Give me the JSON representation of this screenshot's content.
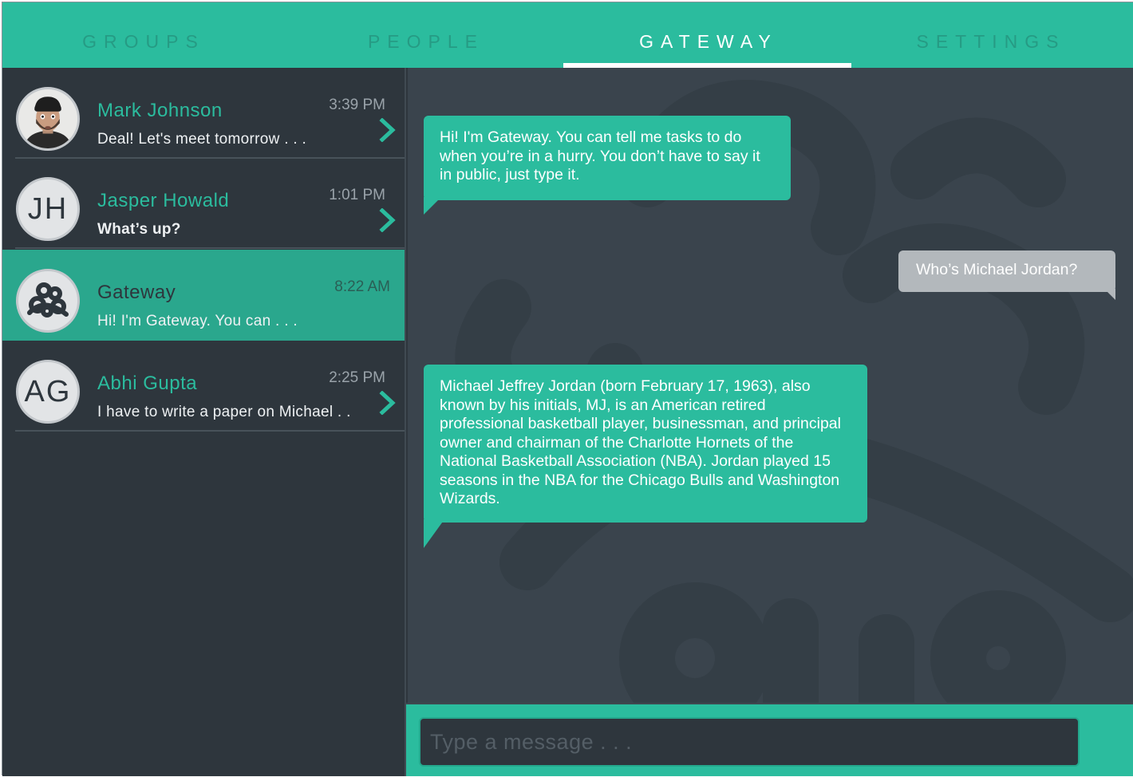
{
  "tabs": [
    {
      "label": "GROUPS"
    },
    {
      "label": "PEOPLE"
    },
    {
      "label": "GATEWAY"
    },
    {
      "label": "SETTINGS"
    }
  ],
  "contacts": [
    {
      "name": "Mark Johnson",
      "time": "3:39 PM",
      "preview": "Deal! Let's meet tomorrow . . .",
      "avatar": "photo"
    },
    {
      "name": "Jasper Howald",
      "time": "1:01 PM",
      "preview": "What’s up?",
      "initials": "JH"
    },
    {
      "name": "Gateway",
      "time": "8:22 AM",
      "preview": "Hi! I'm Gateway. You can . . .",
      "avatar": "gateway-logo"
    },
    {
      "name": "Abhi Gupta",
      "time": "2:25 PM",
      "preview": "I have to write a paper on Michael . .",
      "initials": "AG"
    }
  ],
  "messages": [
    {
      "from": "bot",
      "text": "Hi! I'm Gateway. You can tell me tasks to do when you’re in a hurry. You don’t have to say it in public, just type it."
    },
    {
      "from": "user",
      "text": "Who’s Michael Jordan?"
    },
    {
      "from": "bot",
      "text": "Michael Jeffrey Jordan (born February 17, 1963), also known by his initials, MJ, is an American retired professional basketball player, businessman, and principal owner and chairman of the Charlotte Hornets of the National Basketball Association (NBA). Jordan played 15 seasons in the NBA for the Chicago Bulls and Washington Wizards."
    }
  ],
  "composer": {
    "placeholder": "Type a message . . .",
    "value": ""
  },
  "colors": {
    "accent": "#2bbc9e",
    "background": "#2e363d",
    "chat_background": "#3a444d",
    "user_bubble": "#b3b8bc"
  }
}
